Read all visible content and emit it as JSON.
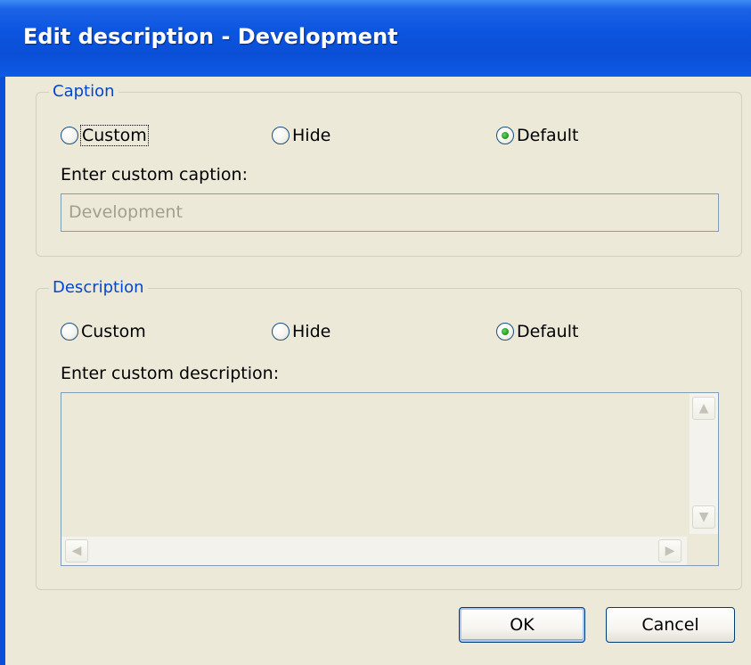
{
  "window": {
    "title": "Edit description - Development"
  },
  "caption_group": {
    "legend": "Caption",
    "options": [
      {
        "label": "Custom",
        "checked": false
      },
      {
        "label": "Hide",
        "checked": false
      },
      {
        "label": "Default",
        "checked": true
      }
    ],
    "field_label": "Enter custom caption:",
    "field_value": "Development"
  },
  "description_group": {
    "legend": "Description",
    "options": [
      {
        "label": "Custom",
        "checked": false
      },
      {
        "label": "Hide",
        "checked": false
      },
      {
        "label": "Default",
        "checked": true
      }
    ],
    "field_label": "Enter custom description:",
    "field_value": ""
  },
  "buttons": {
    "ok_label": "OK",
    "cancel_label": "Cancel"
  },
  "icons": {
    "scroll_up": "scroll-up-arrow-icon",
    "scroll_down": "scroll-down-arrow-icon",
    "scroll_left": "scroll-left-arrow-icon",
    "scroll_right": "scroll-right-arrow-icon"
  },
  "colors": {
    "titlebar": "#0a4fd6",
    "dialog_background": "#ece9d8",
    "group_legend": "#0046d5",
    "radio_checked": "#21a121",
    "disabled_text": "#a29f8f"
  }
}
